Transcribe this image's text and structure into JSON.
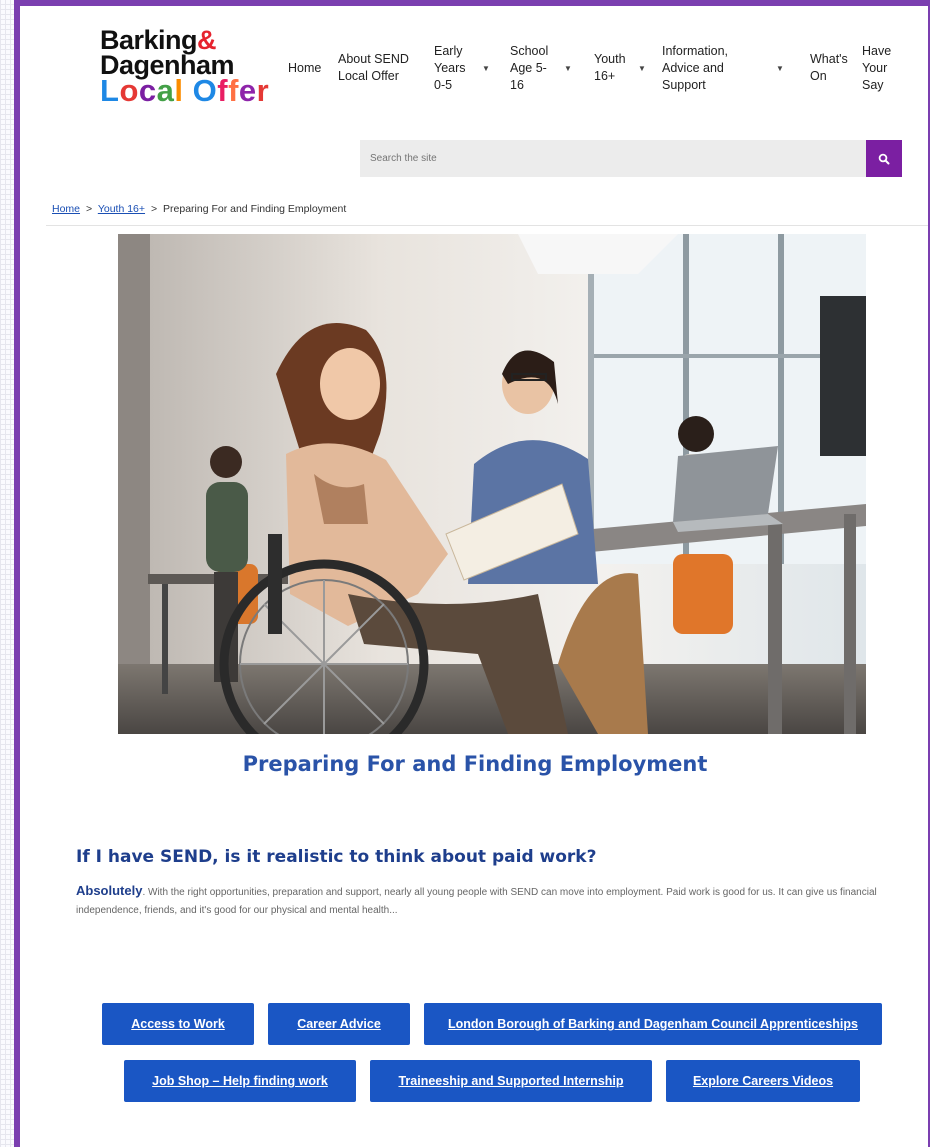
{
  "logo": {
    "line1": "Barking",
    "amp": "&",
    "line2": "Dagenham",
    "line3_letters": [
      "L",
      "o",
      "c",
      "a",
      "l",
      " ",
      "O",
      "f",
      "f",
      "e",
      "r"
    ],
    "line3_colors": [
      "#1e88e5",
      "#e53935",
      "#7b1fa2",
      "#43a047",
      "#fb8c00",
      "#ffffff",
      "#1e88e5",
      "#e91e63",
      "#ff7043",
      "#8e24aa",
      "#e53935"
    ]
  },
  "nav": [
    {
      "label": "Home",
      "dropdown": false
    },
    {
      "label": "About SEND Local Offer",
      "dropdown": false
    },
    {
      "label": "Early Years 0-5",
      "dropdown": true
    },
    {
      "label": "School Age 5-16",
      "dropdown": true
    },
    {
      "label": "Youth 16+",
      "dropdown": true
    },
    {
      "label": "Information, Advice and Support",
      "dropdown": true
    },
    {
      "label": "What's On",
      "dropdown": false
    },
    {
      "label": "Have Your Say",
      "dropdown": false
    }
  ],
  "search": {
    "placeholder": "Search the site",
    "icon": "search-icon"
  },
  "breadcrumb": {
    "home": "Home",
    "sep": ">",
    "youth": "Youth 16+",
    "current": "Preparing For and Finding Employment"
  },
  "page": {
    "title": "Preparing For and Finding Employment",
    "question": "If I have SEND, is it realistic to think about paid work?",
    "answer_lead": "Absolutely",
    "answer_body": ". With the right opportunities, preparation and support, nearly all young people with SEND can move into employment. Paid work is good for us. It can give us financial independence, friends, and it's good for our physical and mental health..."
  },
  "buttons": [
    "Access to Work",
    "Career Advice",
    "London Borough of Barking and Dagenham Council Apprenticeships",
    "Job Shop – Help finding work",
    "Traineeship and Supported Internship",
    "Explore Careers Videos"
  ],
  "colors": {
    "frame": "#7b3fb0",
    "accent": "#7b1fa2",
    "button": "#1a56c4",
    "title": "#2a53a8"
  }
}
